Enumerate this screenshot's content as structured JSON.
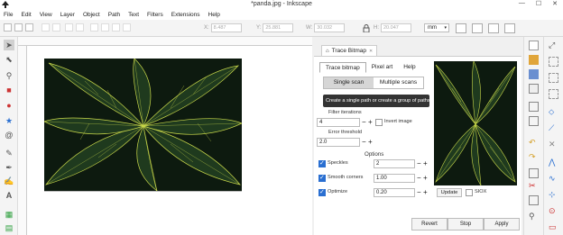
{
  "window": {
    "title": "*panda.jpg - Inkscape",
    "minimize": "—",
    "maximize": "☐",
    "close": "✕"
  },
  "menu": [
    "File",
    "Edit",
    "View",
    "Layer",
    "Object",
    "Path",
    "Text",
    "Filters",
    "Extensions",
    "Help"
  ],
  "toolbar": {
    "x_label": "X:",
    "x_value": "8.487",
    "y_label": "Y:",
    "y_value": "25.881",
    "w_label": "W:",
    "w_value": "30.032",
    "h_label": "H:",
    "h_value": "20.047",
    "unit": "mm"
  },
  "dock": {
    "tab_label": "Trace Bitmap",
    "tab_close": "✕",
    "subtabs": [
      "Trace bitmap",
      "Pixel art",
      "Help"
    ],
    "scan_modes": [
      "Single scan",
      "Multiple scans"
    ],
    "tooltip": "Create a single path or create a group of paths",
    "filter_iterations_label": "Filter iterations",
    "filter_iterations_value": "4",
    "invert_image_label": "Invert image",
    "error_threshold_label": "Error threshold",
    "error_threshold_value": "2.0",
    "options_label": "Options",
    "speckles_label": "Speckles",
    "speckles_value": "2",
    "smooth_corners_label": "Smooth corners",
    "smooth_corners_value": "1.00",
    "optimize_label": "Optimize",
    "optimize_value": "0.20",
    "update_label": "Update",
    "siox_label": "SIOX",
    "revert_label": "Revert",
    "stop_label": "Stop",
    "apply_label": "Apply",
    "minus": "−",
    "plus": "+"
  },
  "colors": {
    "accent": "#2a6fd1",
    "leaf_dark": "#0f1f10",
    "leaf_vein": "#c9d84a"
  }
}
